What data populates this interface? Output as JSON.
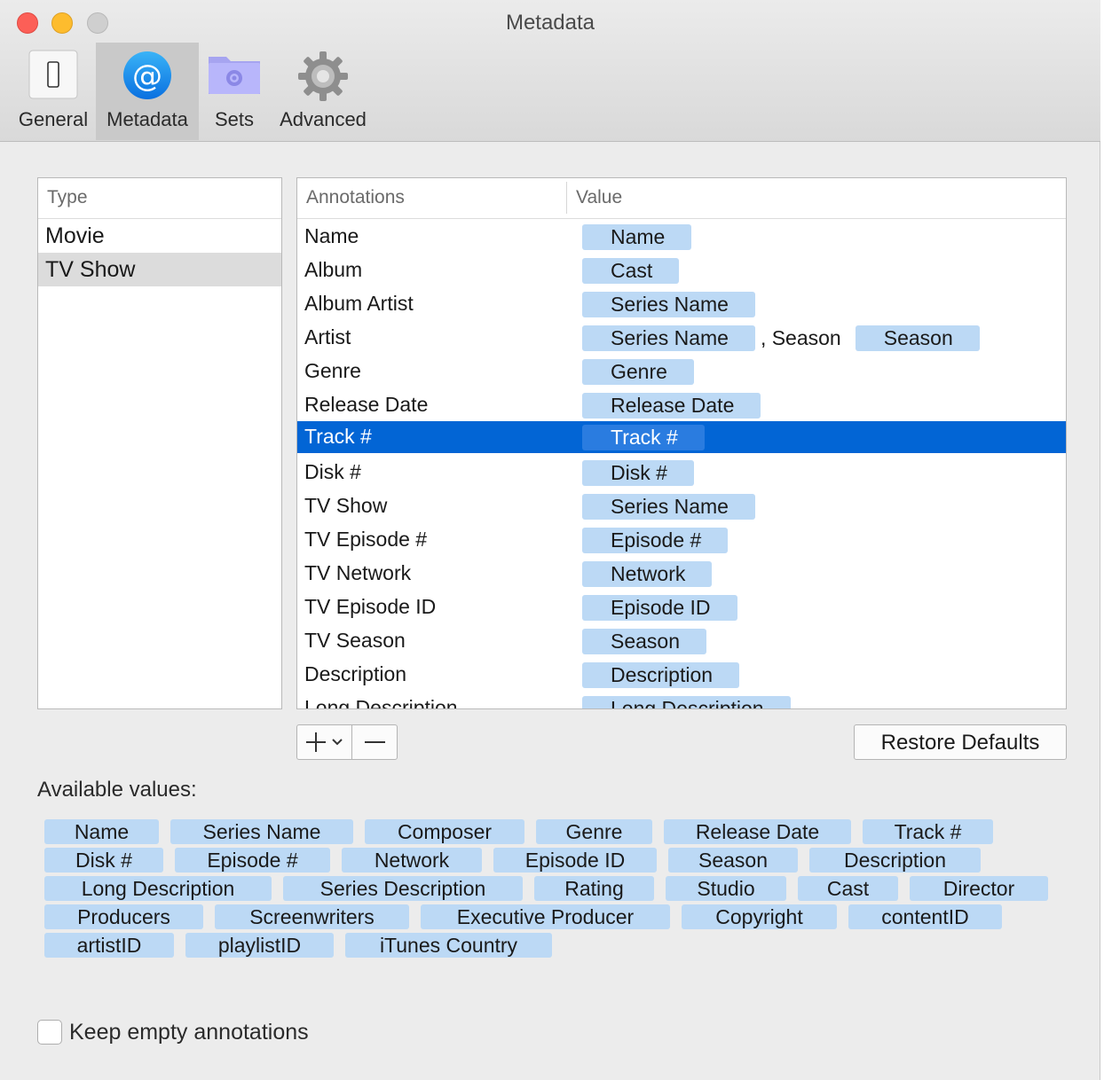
{
  "window": {
    "title": "Metadata",
    "controls": [
      "close",
      "minimize",
      "zoom"
    ]
  },
  "toolbar": {
    "items": [
      {
        "label": "General",
        "icon": "switch-icon",
        "selected": false
      },
      {
        "label": "Metadata",
        "icon": "at-sign-icon",
        "selected": true
      },
      {
        "label": "Sets",
        "icon": "folder-gear-icon",
        "selected": false
      },
      {
        "label": "Advanced",
        "icon": "gear-icon",
        "selected": false
      }
    ]
  },
  "type_list": {
    "header": "Type",
    "items": [
      {
        "label": "Movie",
        "selected": false
      },
      {
        "label": "TV Show",
        "selected": true
      }
    ]
  },
  "annotations": {
    "headers": {
      "annotation": "Annotations",
      "value": "Value"
    },
    "rows": [
      {
        "name": "Name",
        "tokens": [
          "Name"
        ]
      },
      {
        "name": "Album",
        "tokens": [
          "Cast"
        ]
      },
      {
        "name": "Album Artist",
        "tokens": [
          "Series Name"
        ]
      },
      {
        "name": "Artist",
        "tokens": [
          "Series Name"
        ],
        "separator": ", Season",
        "tokens2": [
          "Season"
        ]
      },
      {
        "name": "Genre",
        "tokens": [
          "Genre"
        ]
      },
      {
        "name": "Release Date",
        "tokens": [
          "Release Date"
        ]
      },
      {
        "name": "Track #",
        "tokens": [
          "Track #"
        ],
        "selected": true
      },
      {
        "name": "Disk #",
        "tokens": [
          "Disk #"
        ]
      },
      {
        "name": "TV Show",
        "tokens": [
          "Series Name"
        ]
      },
      {
        "name": "TV Episode #",
        "tokens": [
          "Episode #"
        ]
      },
      {
        "name": "TV Network",
        "tokens": [
          "Network"
        ]
      },
      {
        "name": "TV Episode ID",
        "tokens": [
          "Episode ID"
        ]
      },
      {
        "name": "TV Season",
        "tokens": [
          "Season"
        ]
      },
      {
        "name": "Description",
        "tokens": [
          "Description"
        ]
      },
      {
        "name": "Long Description",
        "tokens": [
          "Long Description"
        ]
      }
    ]
  },
  "buttons": {
    "add": "+",
    "add_menu": "⌄",
    "remove": "—",
    "restore": "Restore Defaults"
  },
  "available": {
    "label": "Available values:",
    "values": [
      "Name",
      "Series Name",
      "Composer",
      "Genre",
      "Release Date",
      "Track #",
      "Disk #",
      "Episode #",
      "Network",
      "Episode ID",
      "Season",
      "Description",
      "Long Description",
      "Series Description",
      "Rating",
      "Studio",
      "Cast",
      "Director",
      "Producers",
      "Screenwriters",
      "Executive Producer",
      "Copyright",
      "contentID",
      "artistID",
      "playlistID",
      "iTunes Country"
    ]
  },
  "options": {
    "keep_empty_label": "Keep empty annotations",
    "keep_empty_checked": false
  }
}
